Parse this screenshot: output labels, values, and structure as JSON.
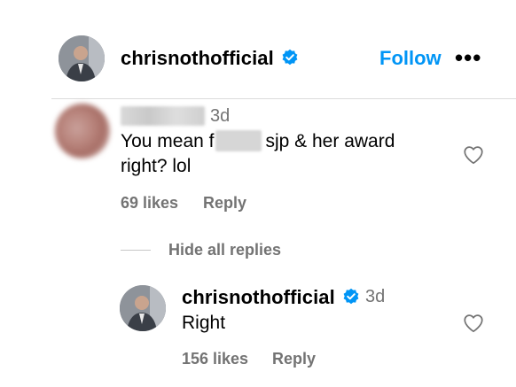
{
  "post_header": {
    "username": "chrisnothofficial",
    "follow_label": "Follow",
    "more_label": "•••",
    "avatar_icon": "user-avatar-icon",
    "verified_icon": "verified-badge-icon"
  },
  "comment": {
    "time": "3d",
    "text_before": "You mean f",
    "text_after": "sjp & her award",
    "text_line2": "right? lol",
    "likes": "69 likes",
    "reply_label": "Reply",
    "like_icon": "heart-outline-icon"
  },
  "replies_toggle": {
    "label": "Hide all replies"
  },
  "reply": {
    "username": "chrisnothofficial",
    "time": "3d",
    "text": "Right",
    "likes": "156 likes",
    "reply_label": "Reply",
    "like_icon": "heart-outline-icon"
  },
  "colors": {
    "accent": "#0095f6",
    "verified": "#0095f6",
    "meta_text": "#737373",
    "divider": "#dbdbdb"
  }
}
